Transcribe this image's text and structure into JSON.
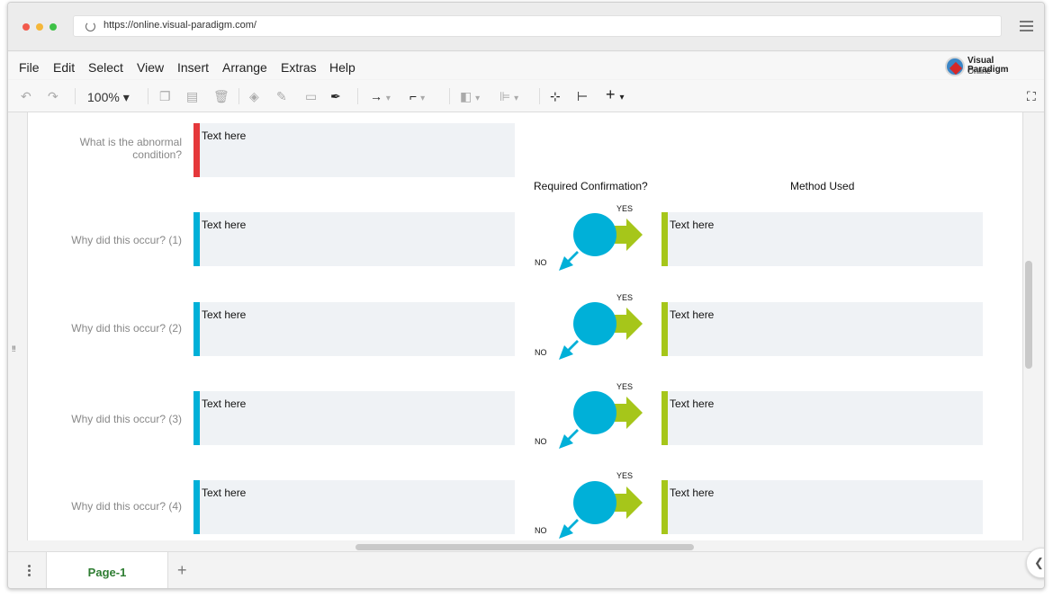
{
  "browser": {
    "url": "https://online.visual-paradigm.com/"
  },
  "menu": {
    "items": [
      "File",
      "Edit",
      "Select",
      "View",
      "Insert",
      "Arrange",
      "Extras",
      "Help"
    ]
  },
  "logo": {
    "name": "Visual Paradigm",
    "sub": "Online"
  },
  "toolbar": {
    "zoom": "100%",
    "icons": [
      "undo-icon",
      "redo-icon",
      "zoom-dropdown",
      "copy-icon",
      "paste-icon",
      "delete-icon",
      "fill-color-icon",
      "line-color-icon",
      "shadow-icon",
      "format-painter-icon",
      "connector-icon",
      "waypoint-icon",
      "to-front-icon",
      "align-icon",
      "fit-page-icon",
      "size-icon",
      "insert-icon",
      "fullscreen-icon"
    ]
  },
  "diagram": {
    "colors": {
      "red": "#e5383b",
      "blue": "#00b0d8",
      "green": "#a6c61a",
      "box": "#eff2f5"
    },
    "headers": {
      "confirmation": "Required Confirmation?",
      "method": "Method Used"
    },
    "top_row": {
      "question": "What is the abnormal condition?",
      "text": "Text here"
    },
    "rows": [
      {
        "question": "Why did this occur? (1)",
        "cause_text": "Text here",
        "method_text": "Text here",
        "yes": "YES",
        "no": "NO"
      },
      {
        "question": "Why did this occur? (2)",
        "cause_text": "Text here",
        "method_text": "Text here",
        "yes": "YES",
        "no": "NO"
      },
      {
        "question": "Why did this occur? (3)",
        "cause_text": "Text here",
        "method_text": "Text here",
        "yes": "YES",
        "no": "NO"
      },
      {
        "question": "Why did this occur? (4)",
        "cause_text": "Text here",
        "method_text": "Text here",
        "yes": "YES",
        "no": "NO"
      }
    ]
  },
  "footer": {
    "page_tab": "Page-1"
  }
}
